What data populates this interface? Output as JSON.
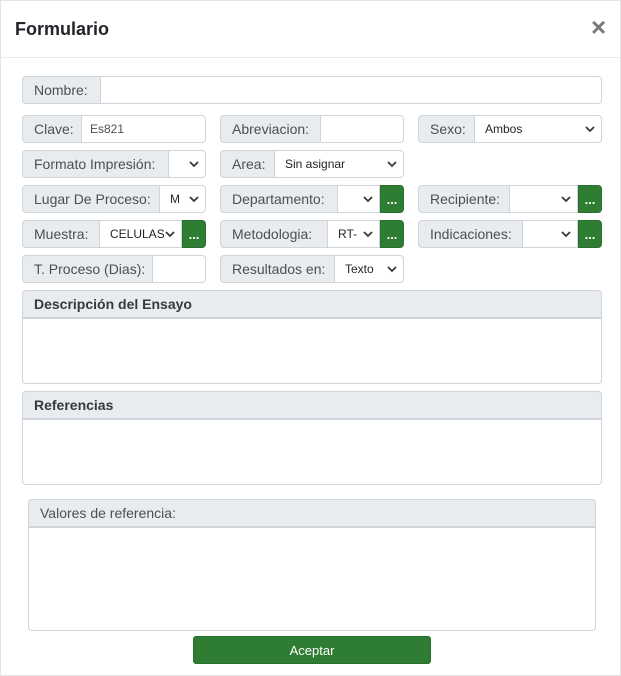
{
  "dialog": {
    "title": "Formulario",
    "close_glyph": "×"
  },
  "fields": {
    "nombre": {
      "label": "Nombre:",
      "value": ""
    },
    "clave": {
      "label": "Clave:",
      "value": "Es821"
    },
    "abreviacion": {
      "label": "Abreviacion:",
      "value": ""
    },
    "sexo": {
      "label": "Sexo:",
      "value": "Ambos"
    },
    "formato_impresion": {
      "label": "Formato Impresión:",
      "value": ""
    },
    "area": {
      "label": "Area:",
      "value": "Sin asignar"
    },
    "lugar_de_proceso": {
      "label": "Lugar De Proceso:",
      "value": "M"
    },
    "departamento": {
      "label": "Departamento:",
      "value": "",
      "button": "..."
    },
    "recipiente": {
      "label": "Recipiente:",
      "value": "",
      "button": "..."
    },
    "muestra": {
      "label": "Muestra:",
      "value": "CELULAS",
      "button": "..."
    },
    "metodologia": {
      "label": "Metodologia:",
      "value": "RT-",
      "button": "..."
    },
    "indicaciones": {
      "label": "Indicaciones:",
      "value": "",
      "button": "..."
    },
    "t_proceso": {
      "label": "T. Proceso (Dias):",
      "value": ""
    },
    "resultados_en": {
      "label": "Resultados en:",
      "value": "Texto"
    }
  },
  "sections": {
    "descripcion": {
      "label": "Descripción del Ensayo",
      "value": ""
    },
    "referencias": {
      "label": "Referencias",
      "value": ""
    },
    "valores_referencia": {
      "label": "Valores de referencia:",
      "value": ""
    }
  },
  "footer": {
    "accept_label": "Aceptar"
  },
  "colors": {
    "accent_green": "#2e7d32",
    "label_bg": "#e9ecef",
    "border": "#ced4da"
  },
  "icons": {
    "close": "close-icon",
    "dropdown": "chevron-down-icon"
  }
}
